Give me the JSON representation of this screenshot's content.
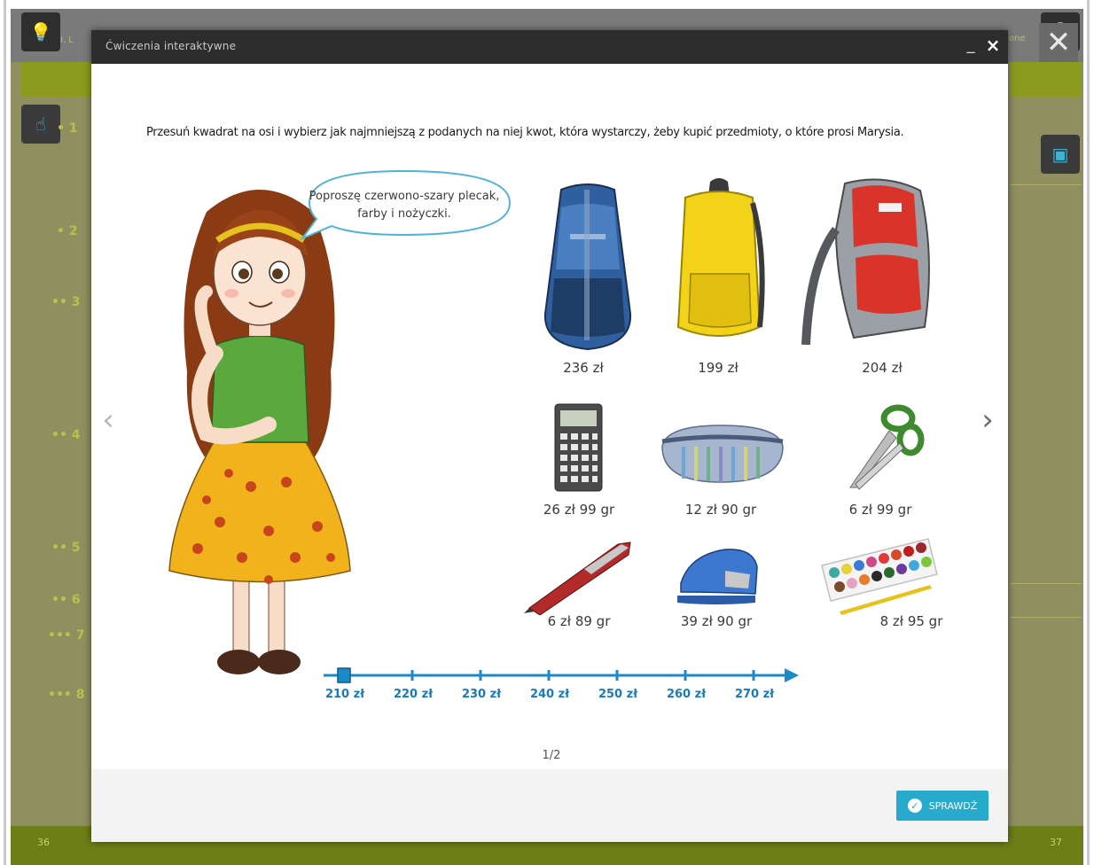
{
  "background": {
    "left_numbers": [
      "1",
      "2",
      "3",
      "4",
      "5",
      "6",
      "7",
      "8"
    ],
    "left_number_prefixes": [
      "•",
      "•",
      "••",
      "••",
      "••",
      "••",
      "•••",
      "•••"
    ],
    "page_left": "36",
    "page_right": "37",
    "header_left_fragment": "I. L",
    "header_right_fragment": "one"
  },
  "modal": {
    "title": "Ćwiczenia interaktywne",
    "minimize_label": "_",
    "close_label": "×"
  },
  "instruction": "Przesuń kwadrat na osi i wybierz jak najmniejszą z podanych na niej kwot, która wystarczy, żeby kupić przedmioty, o które prosi Marysia.",
  "speech_bubble": {
    "line1": "Poproszę czerwono-szary plecak,",
    "line2": "farby i nożyczki."
  },
  "items": [
    {
      "name": "blue-backpack",
      "price": "236 zł"
    },
    {
      "name": "yellow-backpack",
      "price": "199 zł"
    },
    {
      "name": "red-grey-backpack",
      "price": "204 zł"
    },
    {
      "name": "calculator",
      "price": "26 zł 99 gr"
    },
    {
      "name": "pencil-case",
      "price": "12 zł 90 gr"
    },
    {
      "name": "scissors",
      "price": "6 zł 99 gr"
    },
    {
      "name": "pen",
      "price": "6 zł 89 gr"
    },
    {
      "name": "stapler",
      "price": "39 zł 90 gr"
    },
    {
      "name": "paints",
      "price": "8 zł 95 gr"
    }
  ],
  "axis": {
    "labels": [
      "210 zł",
      "220 zł",
      "230 zł",
      "240 zł",
      "250 zł",
      "260 zł",
      "270 zł"
    ],
    "selected_value": "210 zł"
  },
  "pager": "1/2",
  "check_button": "SPRAWDŹ",
  "colors": {
    "accent": "#27aacb",
    "axis": "#1a7ab8",
    "titlebar": "#2d2d2d"
  }
}
